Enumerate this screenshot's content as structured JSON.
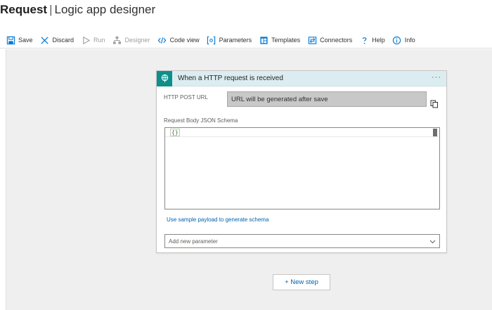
{
  "header": {
    "title_bold": "Request",
    "separator": "|",
    "title_rest": "Logic app designer"
  },
  "toolbar": {
    "items": [
      {
        "label": "Save",
        "icon": "save-icon",
        "enabled": true
      },
      {
        "label": "Discard",
        "icon": "close-icon",
        "enabled": true
      },
      {
        "label": "Run",
        "icon": "play-icon",
        "enabled": false
      },
      {
        "label": "Designer",
        "icon": "designer-icon",
        "enabled": false
      },
      {
        "label": "Code view",
        "icon": "code-icon",
        "enabled": true
      },
      {
        "label": "Parameters",
        "icon": "parameters-icon",
        "enabled": true
      },
      {
        "label": "Templates",
        "icon": "templates-icon",
        "enabled": true
      },
      {
        "label": "Connectors",
        "icon": "connectors-icon",
        "enabled": true
      },
      {
        "label": "Help",
        "icon": "help-icon",
        "enabled": true
      },
      {
        "label": "Info",
        "icon": "info-icon",
        "enabled": true
      }
    ]
  },
  "trigger_card": {
    "title": "When a HTTP request is received",
    "more_label": "···",
    "url_label": "HTTP POST URL",
    "url_value": "URL will be generated after save",
    "schema_label": "Request Body JSON Schema",
    "schema_value": "{}",
    "sample_link": "Use sample payload to generate schema",
    "param_placeholder": "Add new parameter"
  },
  "new_step_label": "+ New step",
  "colors": {
    "accent": "#0062ad",
    "trigger_teal": "#0f8e8a",
    "header_bg": "#dcedf2",
    "canvas_bg": "#efefef"
  }
}
